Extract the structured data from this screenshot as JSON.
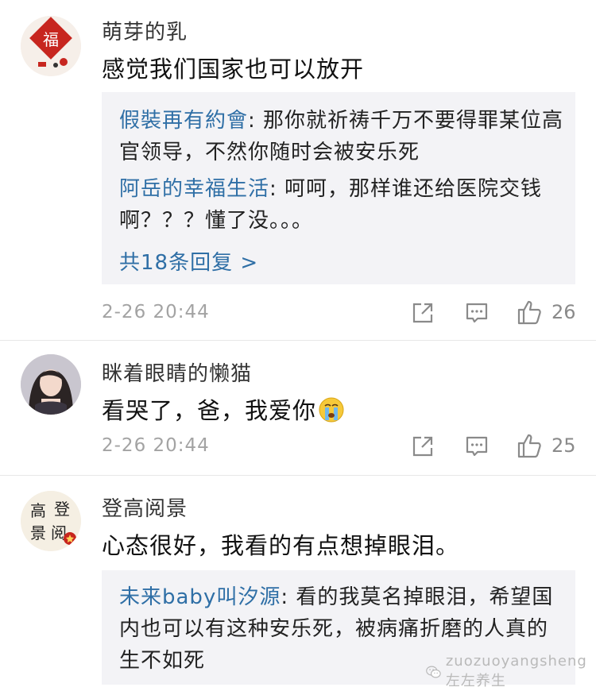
{
  "comments": [
    {
      "username": "萌芽的乳",
      "text": "感觉我们国家也可以放开",
      "avatar_char": "福",
      "replies": [
        {
          "author": "假裝再有約會",
          "text": "那你就祈祷千万不要得罪某位高官领导，不然你随时会被安乐死"
        },
        {
          "author": "阿岳的幸福生活",
          "text": "呵呵，那样谁还给医院交钱啊？？？懂了没。。。"
        }
      ],
      "more": "共18条回复 >",
      "time": "2-26 20:44",
      "likes": "26"
    },
    {
      "username": "眯着眼睛的懒猫",
      "text": "看哭了，爸，我爱你",
      "emoji": "😭",
      "time": "2-26 20:44",
      "likes": "25"
    },
    {
      "username": "登高阅景",
      "text": "心态很好，我看的有点想掉眼泪。",
      "avatar_chars": "高登\n景阅",
      "replies": [
        {
          "author": "未来baby叫汐源",
          "text": "看的我莫名掉眼泪，希望国内也可以有这种安乐死，被病痛折磨的人真的生不如死"
        }
      ]
    }
  ],
  "watermark": "zuozuoyangsheng 左左养生",
  "colors": {
    "link": "#2f6fa6",
    "meta": "#a3a3a3",
    "reply_bg": "#f3f3f6",
    "seal_red": "#c7261f"
  }
}
